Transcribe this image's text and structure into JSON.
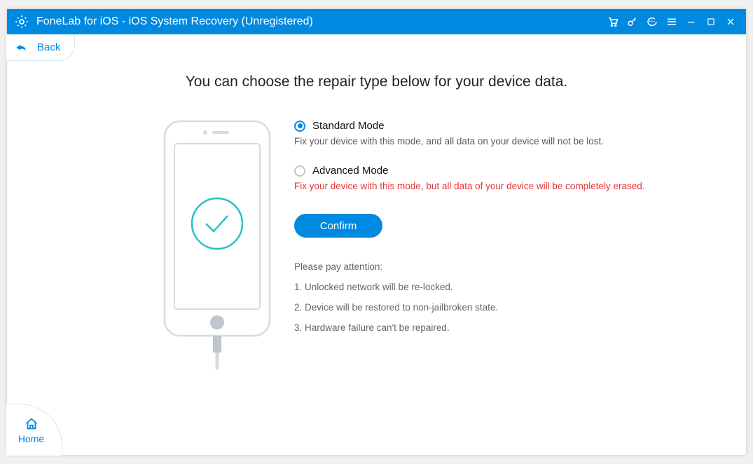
{
  "titlebar": {
    "title": "FoneLab for iOS - iOS System Recovery (Unregistered)"
  },
  "back_label": "Back",
  "headline": "You can choose the repair type below for your device data.",
  "options": {
    "standard": {
      "label": "Standard Mode",
      "desc": "Fix your device with this mode, and all data on your device will not be lost."
    },
    "advanced": {
      "label": "Advanced Mode",
      "desc": "Fix your device with this mode, but all data of your device will be completely erased."
    }
  },
  "confirm_label": "Confirm",
  "notice": {
    "head": "Please pay attention:",
    "lines": [
      "1. Unlocked network will be re-locked.",
      "2. Device will be restored to non-jailbroken state.",
      "3. Hardware failure can't be repaired."
    ]
  },
  "home_label": "Home"
}
